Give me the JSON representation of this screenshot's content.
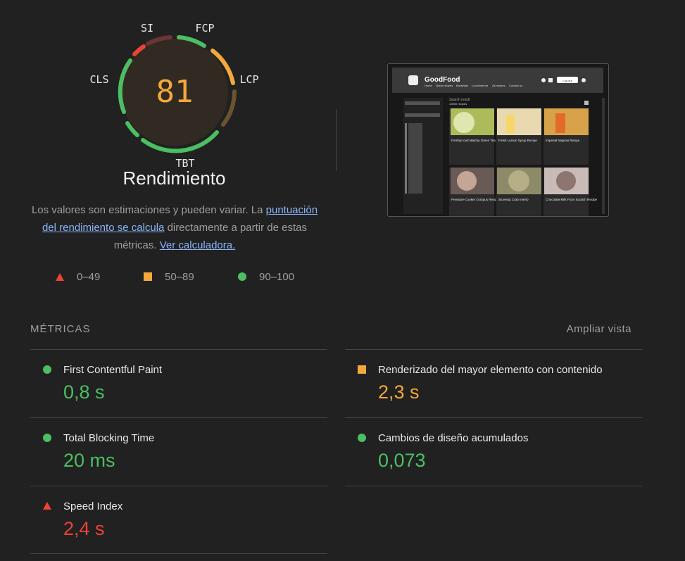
{
  "gauge": {
    "score": "81",
    "label": "Rendimiento",
    "metric_labels": {
      "si": "SI",
      "fcp": "FCP",
      "lcp": "LCP",
      "tbt": "TBT",
      "cls": "CLS"
    },
    "colors": {
      "good": "#4cbe63",
      "average": "#f4a83a",
      "poor": "#eb4436"
    }
  },
  "description": {
    "text_before": "Los valores son estimaciones y pueden variar. La ",
    "link1": "puntuación del rendimiento se calcula",
    "text_middle": " directamente a partir de estas métricas. ",
    "link2": "Ver calculadora."
  },
  "legend": {
    "poor": "0–49",
    "average": "50–89",
    "good": "90–100"
  },
  "screenshot": {
    "brand": "GoodFood",
    "nav": [
      "Home",
      "Quick recipes",
      "Breakfast",
      "Lunch/dinner",
      "All recipes",
      "Contact us"
    ],
    "login": "Log out",
    "result_title": "Search result",
    "result_count": "10000 recipes",
    "cards": [
      "Freshly Iced Matcha Green Tea Recipe",
      "Fresh Lemon Syrup Recipe",
      "Imperial Negroni Recipe",
      "Pressure-Cooker Octopus Recipe",
      "Stovetop Crab Imerio",
      "Chocolate Milk From Scratch Recipe"
    ]
  },
  "metrics": {
    "title": "MÉTRICAS",
    "expand": "Ampliar vista",
    "items": [
      {
        "name": "First Contentful Paint",
        "value": "0,8 s",
        "status": "good"
      },
      {
        "name": "Renderizado del mayor elemento con contenido",
        "value": "2,3 s",
        "status": "average"
      },
      {
        "name": "Total Blocking Time",
        "value": "20 ms",
        "status": "good"
      },
      {
        "name": "Cambios de diseño acumulados",
        "value": "0,073",
        "status": "good"
      },
      {
        "name": "Speed Index",
        "value": "2,4 s",
        "status": "poor"
      }
    ]
  }
}
